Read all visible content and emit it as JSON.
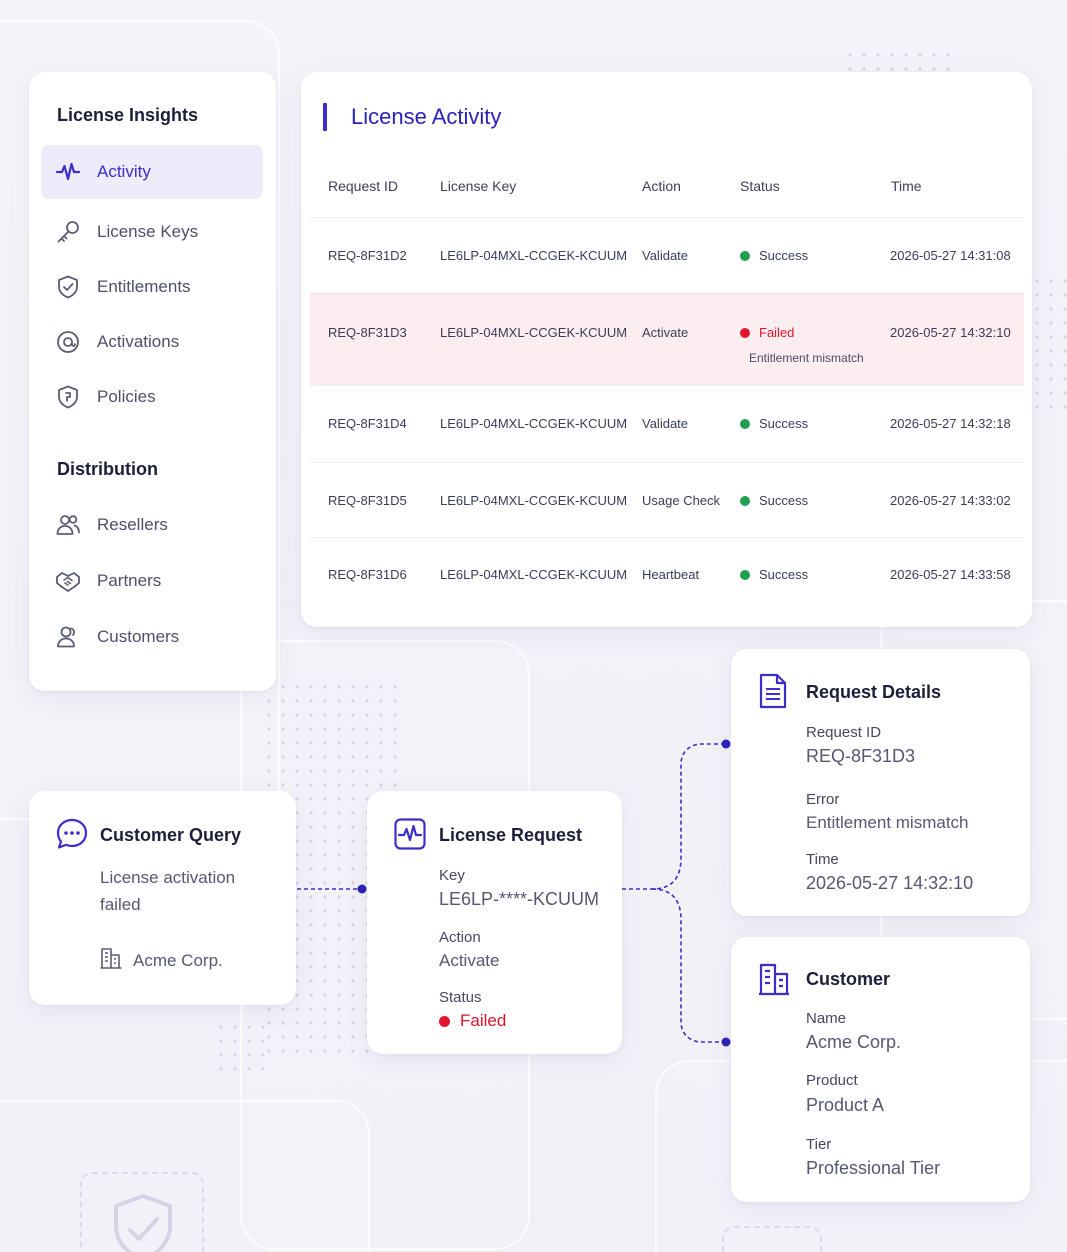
{
  "colors": {
    "accent": "#3b2fc7",
    "success": "#20a04f",
    "danger": "#e0172c",
    "fail_row_bg": "#fcedf0"
  },
  "sidebar": {
    "sections": [
      {
        "title": "License Insights"
      },
      {
        "title": "Distribution"
      }
    ],
    "items": [
      {
        "label": "Activity",
        "icon": "activity-pulse-icon",
        "active": true
      },
      {
        "label": "License Keys",
        "icon": "key-icon"
      },
      {
        "label": "Entitlements",
        "icon": "shield-check-icon"
      },
      {
        "label": "Activations",
        "icon": "activation-icon"
      },
      {
        "label": "Policies",
        "icon": "policy-shield-icon"
      },
      {
        "label": "Resellers",
        "icon": "users-icon"
      },
      {
        "label": "Partners",
        "icon": "handshake-icon"
      },
      {
        "label": "Customers",
        "icon": "customers-icon"
      }
    ]
  },
  "activity": {
    "title": "License Activity",
    "columns": [
      "Request ID",
      "License Key",
      "Action",
      "Status",
      "Time"
    ],
    "rows": [
      {
        "request_id": "REQ-8F31D2",
        "license_key": "LE6LP-04MXL-CCGEK-KCUUM",
        "action": "Validate",
        "status": "Success",
        "time": "2026-05-27 14:31:08"
      },
      {
        "request_id": "REQ-8F31D3",
        "license_key": "LE6LP-04MXL-CCGEK-KCUUM",
        "action": "Activate",
        "status": "Failed",
        "note": "Entitlement mismatch",
        "time": "2026-05-27 14:32:10"
      },
      {
        "request_id": "REQ-8F31D4",
        "license_key": "LE6LP-04MXL-CCGEK-KCUUM",
        "action": "Validate",
        "status": "Success",
        "time": "2026-05-27 14:32:18"
      },
      {
        "request_id": "REQ-8F31D5",
        "license_key": "LE6LP-04MXL-CCGEK-KCUUM",
        "action": "Usage Check",
        "status": "Success",
        "time": "2026-05-27 14:33:02"
      },
      {
        "request_id": "REQ-8F31D6",
        "license_key": "LE6LP-04MXL-CCGEK-KCUUM",
        "action": "Heartbeat",
        "status": "Success",
        "time": "2026-05-27 14:33:58"
      }
    ]
  },
  "customer_query": {
    "title": "Customer Query",
    "message_line1": "License activation",
    "message_line2": "failed",
    "company": "Acme Corp."
  },
  "license_request": {
    "title": "License Request",
    "key_label": "Key",
    "key_value": "LE6LP-****-KCUUM",
    "action_label": "Action",
    "action_value": "Activate",
    "status_label": "Status",
    "status_value": "Failed"
  },
  "request_details": {
    "title": "Request Details",
    "request_id_label": "Request ID",
    "request_id_value": "REQ-8F31D3",
    "error_label": "Error",
    "error_value": "Entitlement mismatch",
    "time_label": "Time",
    "time_value": "2026-05-27 14:32:10"
  },
  "customer": {
    "title": "Customer",
    "name_label": "Name",
    "name_value": "Acme Corp.",
    "product_label": "Product",
    "product_value": "Product A",
    "tier_label": "Tier",
    "tier_value": "Professional Tier"
  }
}
